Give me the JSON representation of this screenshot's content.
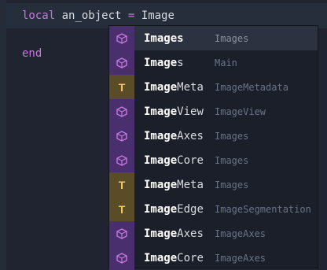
{
  "code": {
    "line1": {
      "keyword": "local",
      "variable": "an_object",
      "operator": "=",
      "value": "Image"
    },
    "line2": {
      "keyword": "end"
    }
  },
  "completions": [
    {
      "kind": "module-icon",
      "match": "Images",
      "rest": "",
      "detail": "Images",
      "selected": true
    },
    {
      "kind": "module-icon",
      "match": "Image",
      "rest": "s",
      "detail": "Main"
    },
    {
      "kind": "type-icon",
      "icon_text": "T",
      "match": "Image",
      "rest": "Meta",
      "detail": "ImageMetadata"
    },
    {
      "kind": "module-icon",
      "match": "Image",
      "rest": "View",
      "detail": "ImageView"
    },
    {
      "kind": "module-icon",
      "match": "Image",
      "rest": "Axes",
      "detail": "Images"
    },
    {
      "kind": "module-icon",
      "match": "Image",
      "rest": "Core",
      "detail": "Images"
    },
    {
      "kind": "type-icon",
      "icon_text": "T",
      "match": "Image",
      "rest": "Meta",
      "detail": "Images"
    },
    {
      "kind": "type-icon",
      "icon_text": "T",
      "match": "Image",
      "rest": "Edge",
      "detail": "ImageSegmentation"
    },
    {
      "kind": "module-icon",
      "match": "Image",
      "rest": "Axes",
      "detail": "ImageAxes"
    },
    {
      "kind": "module-icon",
      "match": "Image",
      "rest": "Core",
      "detail": "ImageAxes"
    }
  ],
  "colors": {
    "keyword": "#c678dd",
    "module_icon": "#c678dd",
    "type_icon": "#f3c66b"
  }
}
